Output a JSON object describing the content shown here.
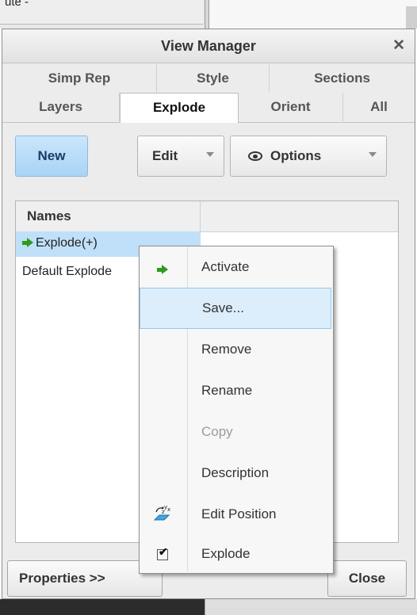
{
  "background": {
    "fragment_text": "ute -"
  },
  "dialog": {
    "title": "View Manager",
    "close_glyph": "✕",
    "tabs_row1": [
      "Simp Rep",
      "Style",
      "Sections"
    ],
    "tabs_row2": [
      "Layers",
      "Explode",
      "Orient",
      "All"
    ],
    "active_tab": "Explode",
    "toolbar": {
      "new_label": "New",
      "edit_label": "Edit",
      "options_label": "Options"
    },
    "list": {
      "column_header": "Names",
      "rows": [
        "Explode(+)",
        "Default Explode"
      ],
      "selected_row": "Explode(+)"
    },
    "footer": {
      "properties_label": "Properties >>",
      "close_label": "Close"
    }
  },
  "context_menu": {
    "items": [
      {
        "label": "Activate",
        "icon": "green-arrow-icon",
        "enabled": true
      },
      {
        "label": "Save...",
        "icon": "",
        "enabled": true,
        "hovered": true
      },
      {
        "label": "Remove",
        "icon": "",
        "enabled": true
      },
      {
        "label": "Rename",
        "icon": "",
        "enabled": true
      },
      {
        "label": "Copy",
        "icon": "",
        "enabled": false
      },
      {
        "label": "Description",
        "icon": "",
        "enabled": true
      },
      {
        "label": "Edit Position",
        "icon": "edit-position-icon",
        "enabled": true
      },
      {
        "label": "Explode",
        "icon": "checkbox-checked-icon",
        "enabled": true,
        "checked": true
      }
    ]
  },
  "colors": {
    "accent": "#bfe0f8",
    "new_button": "#a9d3f5",
    "menu_hover": "#dceefb",
    "green_arrow": "#2e9a1e"
  }
}
